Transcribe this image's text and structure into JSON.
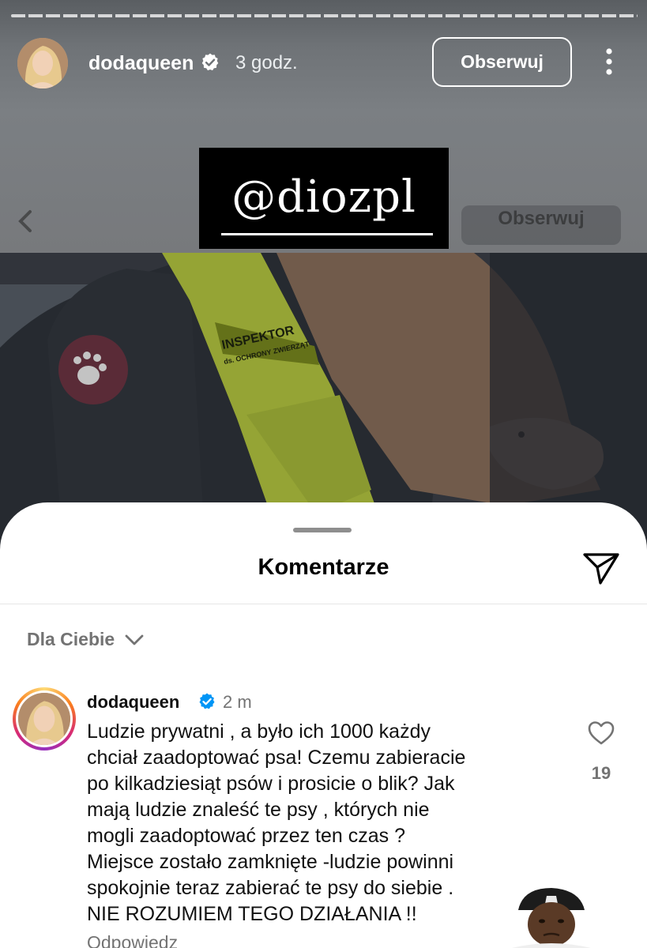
{
  "story": {
    "username": "dodaqueen",
    "time": "3 godz.",
    "follow_label": "Obserwuj",
    "sticker_text": "@diozpl",
    "ghost_follow_label": "Obserwuj",
    "photo_text": {
      "badge_line1": "INSPEKTOR",
      "badge_line2": "ds. OCHRONY ZWIERZĄT"
    }
  },
  "comments_sheet": {
    "title": "Komentarze",
    "filter_label": "Dla Ciebie",
    "comment": {
      "username": "dodaqueen",
      "time": "2 m",
      "lines": [
        "Ludzie prywatni , a było ich 1000 każdy",
        "chciał  zaadoptować psa! Czemu zabieracie",
        "po kilkadziesiąt psów i prosicie o blik? Jak",
        "mają ludzie znaleść te psy , których nie",
        "mogli zaadoptować przez ten czas ?",
        "Miejsce zostało zamknięte -ludzie powinni",
        "spokojnie teraz zabierać te psy do siebie .",
        "NIE ROZUMIEM TEGO DZIAŁANIA !!"
      ],
      "likes": "19",
      "reply_peek": "Odpowiedz"
    }
  },
  "icons": {
    "verified": "verified-badge-icon",
    "more": "more-vertical-icon",
    "share": "share-icon",
    "chevron": "chevron-down-icon",
    "like": "heart-icon"
  },
  "colors": {
    "verified_blue": "#0095f6",
    "vest_yellow": "#c7e23a",
    "sheet_bg": "#ffffff",
    "muted_text": "#737373"
  }
}
